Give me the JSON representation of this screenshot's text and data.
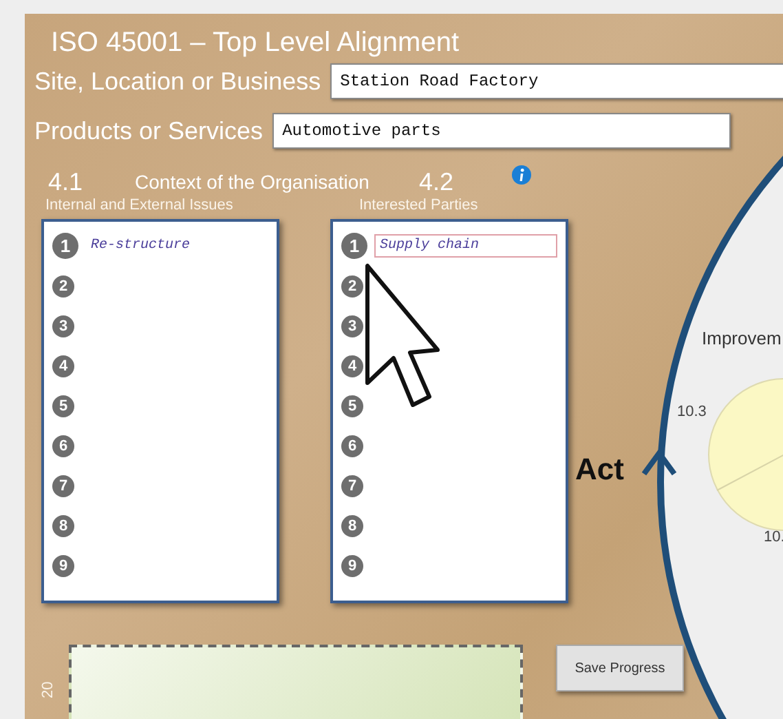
{
  "title": "ISO 45001 – Top Level Alignment",
  "fields": [
    {
      "label": "Site, Location or Business",
      "value": "Station Road Factory"
    },
    {
      "label": "Products or Services",
      "value": "Automotive parts"
    }
  ],
  "context": {
    "number": "4.1",
    "heading": "Context of the Organisation",
    "second_number": "4.2"
  },
  "lists": [
    {
      "subtitle": "Internal and External Issues",
      "items": [
        {
          "number": "1",
          "text": "Re-structure",
          "focused": false
        },
        {
          "number": "2"
        },
        {
          "number": "3"
        },
        {
          "number": "4"
        },
        {
          "number": "5"
        },
        {
          "number": "6"
        },
        {
          "number": "7"
        },
        {
          "number": "8"
        },
        {
          "number": "9"
        }
      ]
    },
    {
      "subtitle": "Interested Parties",
      "items": [
        {
          "number": "1",
          "text": "Supply chain",
          "focused": true
        },
        {
          "number": "2"
        },
        {
          "number": "3"
        },
        {
          "number": "4"
        },
        {
          "number": "5"
        },
        {
          "number": "6"
        },
        {
          "number": "7"
        },
        {
          "number": "8"
        },
        {
          "number": "9"
        }
      ]
    }
  ],
  "side_label": "20",
  "save_button": "Save Progress",
  "diagram": {
    "cycle_label": "Act",
    "heading": "Improvem",
    "pie_labels": [
      "10.3",
      "10."
    ]
  }
}
